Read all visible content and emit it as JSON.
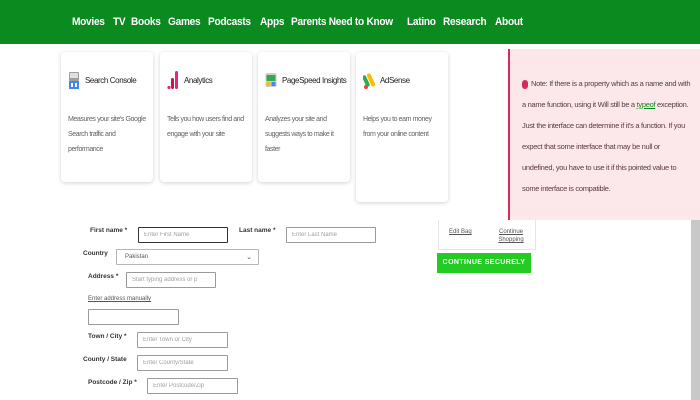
{
  "nav": {
    "items": [
      "Movies",
      "TV",
      "Books",
      "Games",
      "Podcasts",
      "Apps",
      "Parents Need to Know",
      "Latino",
      "Research",
      "About"
    ]
  },
  "cards": [
    {
      "title": "Search Console",
      "desc": "Measures your site's Google Search traffic and performance",
      "icon": "search-console-icon"
    },
    {
      "title": "Analytics",
      "desc": "Tells you how users find and engage with your site",
      "icon": "analytics-icon"
    },
    {
      "title": "PageSpeed Insights",
      "desc": "Analyzes your site and suggests ways to make it faster",
      "icon": "pagespeed-icon"
    },
    {
      "title": "AdSense",
      "desc": "Helps you to earn money from your online content",
      "icon": "adsense-icon"
    }
  ],
  "notice": {
    "line1": "Note: If there is a property which as a name and with a name function, using it",
    "code": "typeof",
    "line2a": "Will still be a",
    "line2b": "exception. Just the interface can determine if it's a function. If you expect that some interface that may be null or undefined, you have to use it if this pointed value to some interface is compatible."
  },
  "form": {
    "first_name_label": "First name *",
    "first_name_placeholder": "Enter First Name",
    "last_name_label": "Last name *",
    "last_name_placeholder": "Enter Last Name",
    "country_label": "Country",
    "country_value": "Pakistan",
    "address_label": "Address *",
    "address_placeholder": "Start typing address or p",
    "manual_link": "Enter address manually",
    "town_label": "Town / City *",
    "town_placeholder": "Enter Town or City",
    "county_label": "County / State",
    "county_placeholder": "Enter County/State",
    "postcode_label": "Postcode / Zip *",
    "postcode_placeholder": "Enter Postcode/Zip"
  },
  "summary": {
    "edit_bag": "Edit Bag",
    "continue_shopping": "Continue Shopping",
    "continue_securely": "CONTINUE SECURELY"
  },
  "colors": {
    "nav_green": "#0a8a1f",
    "button_green": "#22cc22",
    "notice_pink": "#fce8ea",
    "notice_accent": "#d52b5c"
  }
}
